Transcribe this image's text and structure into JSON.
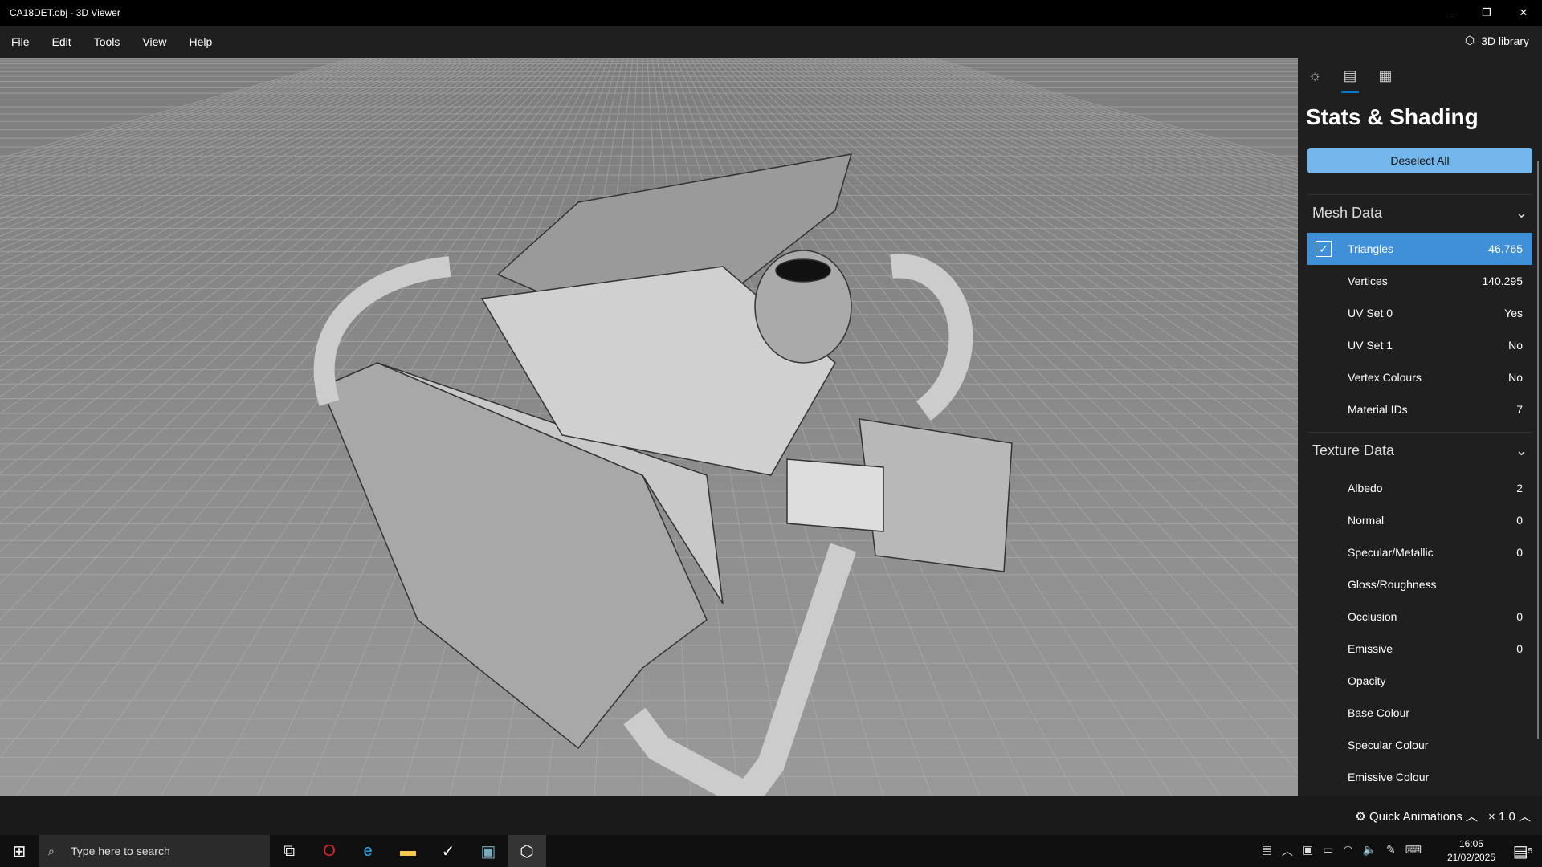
{
  "window": {
    "title": "CA18DET.obj - 3D Viewer",
    "min": "–",
    "restore": "❐",
    "close": "✕"
  },
  "menu": [
    "File",
    "Edit",
    "Tools",
    "View",
    "Help"
  ],
  "library_label": "3D library",
  "panel": {
    "title": "Stats & Shading",
    "deselect_label": "Deselect All",
    "mesh_header": "Mesh Data",
    "mesh_rows": [
      {
        "label": "Triangles",
        "value": "46.765",
        "checked": true
      },
      {
        "label": "Vertices",
        "value": "140.295"
      },
      {
        "label": "UV Set 0",
        "value": "Yes"
      },
      {
        "label": "UV Set 1",
        "value": "No"
      },
      {
        "label": "Vertex Colours",
        "value": "No"
      },
      {
        "label": "Material IDs",
        "value": "7"
      }
    ],
    "texture_header": "Texture Data",
    "texture_rows": [
      {
        "label": "Albedo",
        "value": "2"
      },
      {
        "label": "Normal",
        "value": "0"
      },
      {
        "label": "Specular/Metallic",
        "value": "0"
      },
      {
        "label": "Gloss/Roughness",
        "value": ""
      },
      {
        "label": "Occlusion",
        "value": "0"
      },
      {
        "label": "Emissive",
        "value": "0"
      },
      {
        "label": "Opacity",
        "value": ""
      },
      {
        "label": "Base Colour",
        "value": ""
      },
      {
        "label": "Specular Colour",
        "value": ""
      },
      {
        "label": "Emissive Colour",
        "value": ""
      }
    ]
  },
  "bottom": {
    "quick_animations": "Quick Animations",
    "zoom": "× 1.0"
  },
  "taskbar": {
    "search_placeholder": "Type here to search",
    "time": "16:05",
    "date": "21/02/2025",
    "notifications": "5"
  },
  "colors": {
    "accent": "#0078d4",
    "selected_row": "#3f8fd9",
    "button": "#72b6ec"
  }
}
